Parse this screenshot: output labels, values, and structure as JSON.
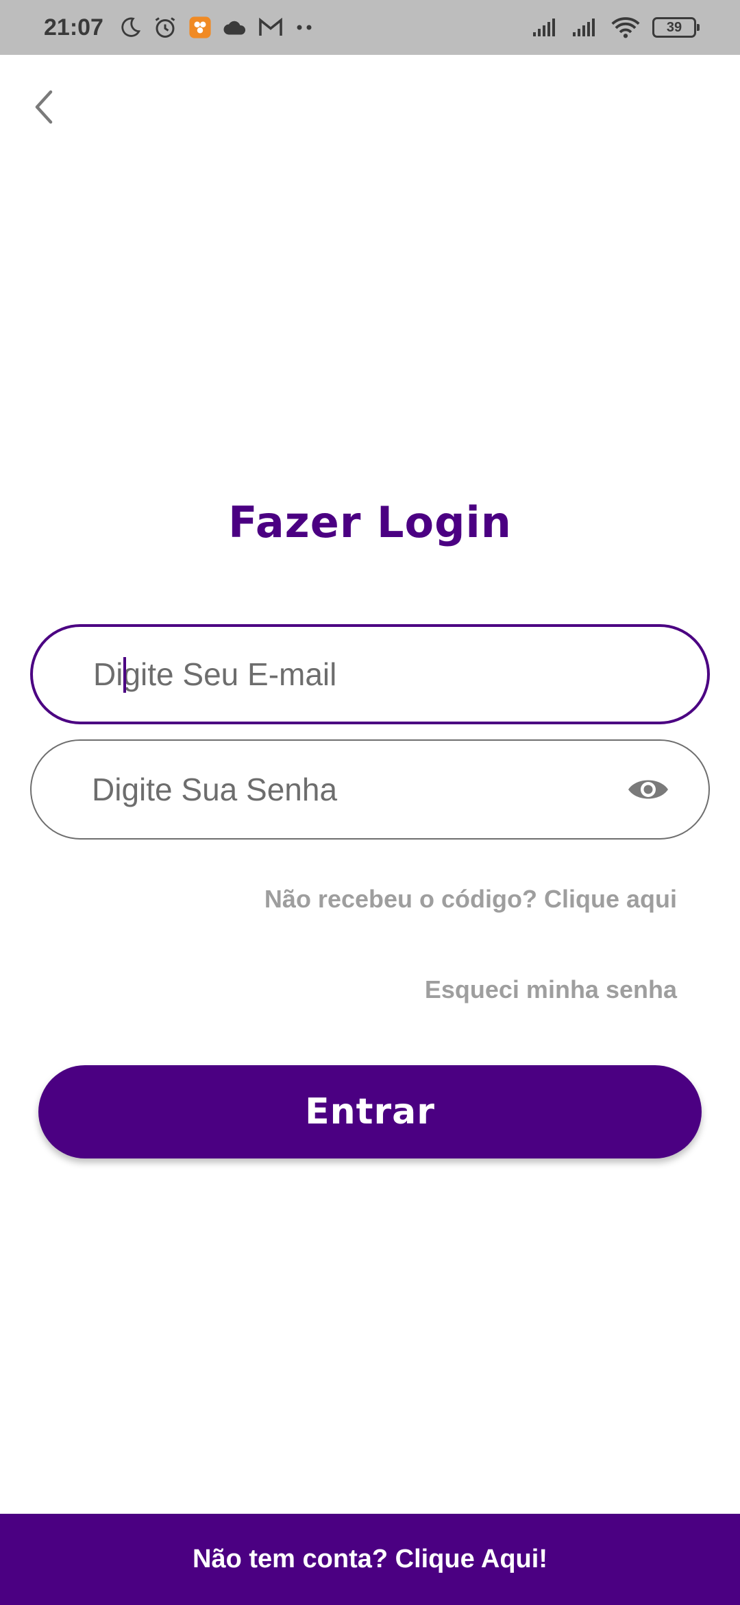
{
  "status_bar": {
    "time": "21:07",
    "battery_level": "39",
    "icons": [
      "moon-icon",
      "alarm-icon",
      "app-notification-icon",
      "cloud-icon",
      "gmail-icon",
      "more-dots-icon",
      "signal-icon",
      "signal-icon",
      "wifi-icon",
      "battery-icon"
    ]
  },
  "header": {
    "back_icon": "chevron-left-icon"
  },
  "page": {
    "title": "Fazer Login"
  },
  "form": {
    "email_placeholder": "Digite Seu E-mail",
    "email_value": "",
    "password_placeholder": "Digite Sua Senha",
    "password_value": "",
    "password_toggle_icon": "eye-icon"
  },
  "links": {
    "resend_code": "Não recebeu o código? Clique aqui",
    "forgot_password": "Esqueci minha senha"
  },
  "actions": {
    "submit_label": "Entrar"
  },
  "footer": {
    "signup_text": "Não tem conta? Clique Aqui!"
  },
  "colors": {
    "brand_purple": "#4b0082",
    "status_bar_bg": "#bdbdbd",
    "link_gray": "#9e9e9e"
  }
}
